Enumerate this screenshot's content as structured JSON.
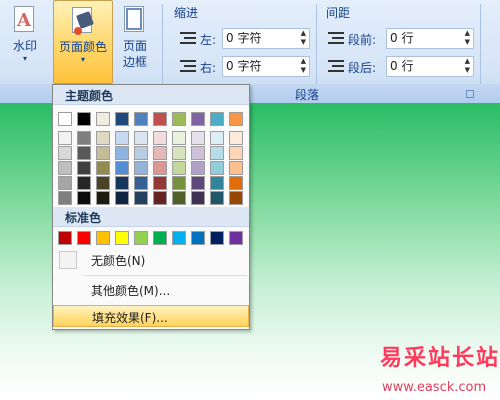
{
  "ribbon": {
    "watermark_label": "水印",
    "pagecolor_label1": "页面颜色",
    "pagecolor_arrow": "▾",
    "watermark_arrow": "▾",
    "pageborder_label1": "页面",
    "pageborder_label2": "边框",
    "indent_title": "缩进",
    "spacing_title": "间距",
    "left_label": "左:",
    "left_value": "0 字符",
    "right_label": "右:",
    "right_value": "0 字符",
    "before_label": "段前:",
    "before_value": "0 行",
    "after_label": "段后:",
    "after_value": "0 行",
    "paragraph_label": "段落"
  },
  "menu": {
    "theme_header": "主题颜色",
    "standard_header": "标准色",
    "theme_top": [
      "#ffffff",
      "#000000",
      "#eeece1",
      "#1f497d",
      "#4f81bd",
      "#c0504d",
      "#9bbb59",
      "#8064a2",
      "#4bacc6",
      "#f79646"
    ],
    "theme_shades": [
      [
        "#f2f2f2",
        "#d8d8d8",
        "#bfbfbf",
        "#a5a5a5",
        "#7f7f7f"
      ],
      [
        "#7f7f7f",
        "#595959",
        "#3f3f3f",
        "#262626",
        "#0c0c0c"
      ],
      [
        "#ddd9c3",
        "#c4bd97",
        "#938953",
        "#494429",
        "#1d1b10"
      ],
      [
        "#c6d9f0",
        "#8db3e2",
        "#548dd4",
        "#17365d",
        "#0f243e"
      ],
      [
        "#dbe5f1",
        "#b8cce4",
        "#95b3d7",
        "#366092",
        "#244061"
      ],
      [
        "#f2dcdb",
        "#e5b9b7",
        "#d99694",
        "#953734",
        "#632423"
      ],
      [
        "#ebf1dd",
        "#d7e3bc",
        "#c3d69b",
        "#76923c",
        "#4f6128"
      ],
      [
        "#e5e0ec",
        "#ccc1d9",
        "#b2a2c7",
        "#5f497a",
        "#3f3151"
      ],
      [
        "#dbeef3",
        "#b7dde8",
        "#92cddc",
        "#31859b",
        "#205867"
      ],
      [
        "#fdeada",
        "#fbd5b5",
        "#fac08f",
        "#e36c09",
        "#974806"
      ]
    ],
    "standard": [
      "#c00000",
      "#ff0000",
      "#ffc000",
      "#ffff00",
      "#92d050",
      "#00b050",
      "#00b0f0",
      "#0070c0",
      "#002060",
      "#7030a0"
    ],
    "no_color": "无颜色(N)",
    "more_colors": "其他颜色(M)...",
    "fill_effects": "填充效果(F)..."
  },
  "watermark": {
    "text": "易采站长站",
    "url": "www.easck.com"
  }
}
